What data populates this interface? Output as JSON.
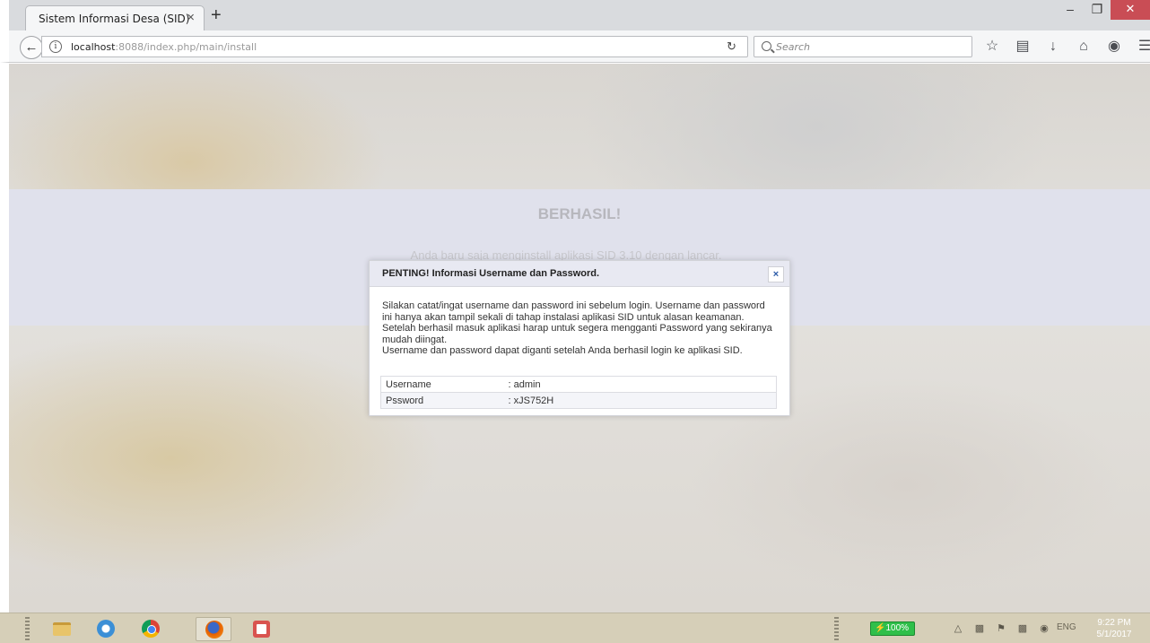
{
  "browser": {
    "tab_title": "Sistem Informasi Desa (SID)",
    "tab_close": "×",
    "new_tab": "+",
    "window_controls": {
      "minimize": "–",
      "restore": "❐",
      "close": "✕"
    },
    "back": "←",
    "url_host": "localhost",
    "url_rest": ":8088/index.php/main/install",
    "reload": "C",
    "search_placeholder": "Search",
    "toolbar_icons": [
      "bookmark-star-icon",
      "reading-list-icon",
      "download-icon",
      "home-icon",
      "pocket-icon",
      "menu-icon"
    ]
  },
  "page": {
    "heading": "BERHASIL!",
    "subtext": "Anda baru saja menginstall aplikasi SID 3.10 dengan lancar."
  },
  "dialog": {
    "title": "PENTING! Informasi Username dan Password.",
    "close": "×",
    "paragraphs": [
      "Silakan catat/ingat username dan password ini sebelum login. Username dan password ini hanya akan tampil sekali di tahap instalasi aplikasi SID untuk alasan keamanan.",
      "Setelah berhasil masuk aplikasi harap untuk segera mengganti Password yang sekiranya mudah diingat.",
      "Username dan password dapat diganti setelah Anda berhasil login ke aplikasi SID."
    ],
    "credentials": [
      {
        "label": "Username",
        "value": ": admin"
      },
      {
        "label": "Pssword",
        "value": ": xJS752H"
      }
    ]
  },
  "taskbar": {
    "apps": [
      "file-explorer-icon",
      "internet-explorer-icon",
      "chrome-icon",
      "firefox-icon",
      "app-icon"
    ],
    "battery": "100%",
    "language": "ENG",
    "time": "9:22 PM",
    "date": "5/1/2017"
  }
}
